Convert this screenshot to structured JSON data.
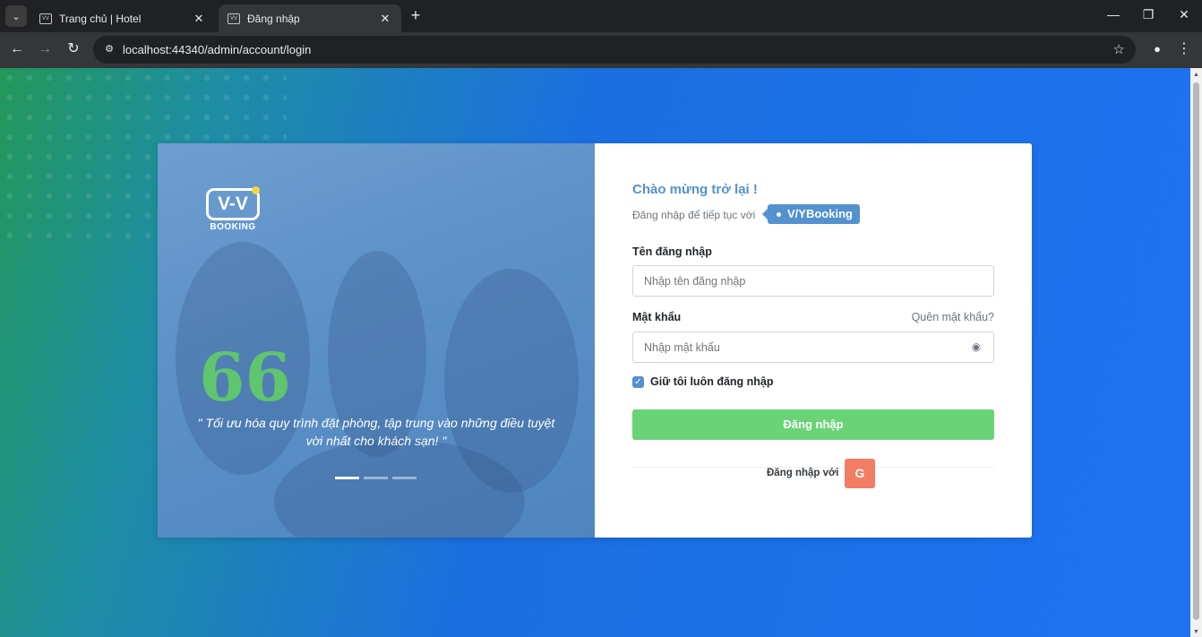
{
  "browser": {
    "tabs": [
      {
        "label": "Trang chủ | Hotel",
        "active": false
      },
      {
        "label": "Đăng nhập",
        "active": true
      }
    ],
    "url": "localhost:44340/admin/account/login"
  },
  "left_panel": {
    "logo_mark": "V-V",
    "logo_text": "BOOKING",
    "quote_mark": "66",
    "quote": "\" Tối ưu hóa quy trình đặt phòng, tập trung vào những điều tuyệt vời nhất cho khách sạn! \"",
    "carousel": {
      "count": 3,
      "active_index": 0
    }
  },
  "login": {
    "welcome": "Chào mừng trở lại !",
    "subtitle": "Đăng nhập để tiếp tục với",
    "brand": "V/YBooking",
    "username_label": "Tên đăng nhập",
    "username_placeholder": "Nhập tên đăng nhập",
    "password_label": "Mật khẩu",
    "forgot_password": "Quên mật khẩu?",
    "password_placeholder": "Nhập mật khẩu",
    "remember_label": "Giữ tôi luôn đăng nhập",
    "remember_checked": true,
    "submit_label": "Đăng nhập",
    "social_label": "Đăng nhập với",
    "google_label": "G"
  },
  "colors": {
    "accent": "#5391cf",
    "submit": "#6ad377",
    "google": "#f27d63",
    "quote_icon": "#5fc56f"
  }
}
